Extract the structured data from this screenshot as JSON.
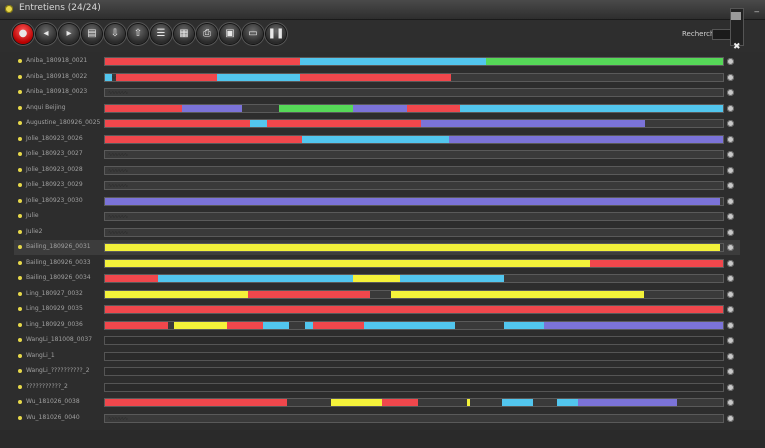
{
  "window": {
    "title": "Entretiens (24/24)",
    "minimize_label": "_"
  },
  "toolbar": {
    "buttons": [
      {
        "name": "record-button",
        "icon": "●"
      },
      {
        "name": "back-button",
        "icon": "◂"
      },
      {
        "name": "forward-button",
        "icon": "▸"
      },
      {
        "name": "document-button",
        "icon": "▤"
      },
      {
        "name": "import-button",
        "icon": "⇩"
      },
      {
        "name": "export-button",
        "icon": "⇧"
      },
      {
        "name": "list-button",
        "icon": "☰"
      },
      {
        "name": "grid-button",
        "icon": "▦"
      },
      {
        "name": "print-button",
        "icon": "⎙"
      },
      {
        "name": "archive-button",
        "icon": "▣"
      },
      {
        "name": "screen-button",
        "icon": "▭"
      },
      {
        "name": "pause-button",
        "icon": "❚❚"
      }
    ],
    "search_label": "Rechercher",
    "close_label": "✖"
  },
  "colors": {
    "red": "#f0474c",
    "blue": "#52c6ee",
    "green": "#56d858",
    "purple": "#7b73d8",
    "yellow": "#f4f23a",
    "grey": "#3a3a3a"
  },
  "rows": [
    {
      "label": "Aniba_180918_0021",
      "segments": [
        [
          0,
          0.315,
          "red"
        ],
        [
          0.315,
          0.617,
          "blue"
        ],
        [
          0.617,
          1,
          "green"
        ]
      ]
    },
    {
      "label": "Aniba_180918_0022",
      "blob": true,
      "segments": [
        [
          0,
          0.012,
          "blue"
        ],
        [
          0.018,
          0.182,
          "red"
        ],
        [
          0.182,
          0.315,
          "blue"
        ],
        [
          0.315,
          0.56,
          "red"
        ]
      ]
    },
    {
      "label": "Aniba_180918_0023",
      "blob": true,
      "segments": []
    },
    {
      "label": "Anqui Beijing",
      "blob": true,
      "segments": [
        [
          0,
          0.125,
          "red"
        ],
        [
          0.125,
          0.222,
          "purple"
        ],
        [
          0.281,
          0.402,
          "green"
        ],
        [
          0.402,
          0.488,
          "purple"
        ],
        [
          0.488,
          0.574,
          "red"
        ],
        [
          0.574,
          1,
          "blue"
        ]
      ]
    },
    {
      "label": "Augustine_180926_0025",
      "blob": true,
      "segments": [
        [
          0,
          0.234,
          "red"
        ],
        [
          0.234,
          0.262,
          "blue"
        ],
        [
          0.262,
          0.512,
          "red"
        ],
        [
          0.512,
          0.874,
          "purple"
        ]
      ]
    },
    {
      "label": "Jolie_180923_0026",
      "blob": true,
      "segments": [
        [
          0,
          0.318,
          "red"
        ],
        [
          0.318,
          0.556,
          "blue"
        ],
        [
          0.556,
          1,
          "purple"
        ]
      ]
    },
    {
      "label": "Jolie_180923_0027",
      "blob": true,
      "segments": []
    },
    {
      "label": "Jolie_180923_0028",
      "blob": true,
      "segments": []
    },
    {
      "label": "Jolie_180923_0029",
      "blob": true,
      "segments": []
    },
    {
      "label": "Jolie_180923_0030",
      "segments": [
        [
          0,
          0.995,
          "purple"
        ]
      ]
    },
    {
      "label": "Julie",
      "blob": true,
      "segments": []
    },
    {
      "label": "Julie2",
      "blob": true,
      "segments": []
    },
    {
      "label": "Bailing_180926_0031",
      "selected": true,
      "segments": [
        [
          0,
          0.995,
          "yellow"
        ]
      ]
    },
    {
      "label": "Bailing_180926_0033",
      "segments": [
        [
          0,
          0.784,
          "yellow"
        ],
        [
          0.784,
          1,
          "red"
        ]
      ]
    },
    {
      "label": "Bailing_180926_0034",
      "blob": true,
      "segments": [
        [
          0,
          0.086,
          "red"
        ],
        [
          0.086,
          0.402,
          "blue"
        ],
        [
          0.402,
          0.478,
          "yellow"
        ],
        [
          0.478,
          0.646,
          "blue"
        ]
      ]
    },
    {
      "label": "Ling_180927_0032",
      "segments": [
        [
          0,
          0.232,
          "yellow"
        ],
        [
          0.232,
          0.429,
          "red"
        ],
        [
          0.463,
          0.872,
          "yellow"
        ]
      ]
    },
    {
      "label": "Ling_180929_0035",
      "blob": true,
      "segments": [
        [
          0,
          1,
          "red"
        ]
      ]
    },
    {
      "label": "Ling_180929_0036",
      "blob": true,
      "segments": [
        [
          0,
          0.102,
          "red"
        ],
        [
          0.112,
          0.197,
          "yellow"
        ],
        [
          0.197,
          0.255,
          "red"
        ],
        [
          0.255,
          0.298,
          "blue"
        ],
        [
          0.323,
          0.337,
          "blue"
        ],
        [
          0.337,
          0.419,
          "red"
        ],
        [
          0.419,
          0.566,
          "blue"
        ],
        [
          0.645,
          0.71,
          "blue"
        ],
        [
          0.71,
          1,
          "purple"
        ]
      ]
    },
    {
      "label": "WangLi_181008_0037",
      "empty": true,
      "segments": []
    },
    {
      "label": "WangLi_1",
      "empty": true,
      "segments": []
    },
    {
      "label": "WangLi_??????????_2",
      "empty": true,
      "segments": []
    },
    {
      "label": "???????????_2",
      "empty": true,
      "segments": []
    },
    {
      "label": "Wu_181026_0038",
      "blob": true,
      "segments": [
        [
          0,
          0.295,
          "red"
        ],
        [
          0.365,
          0.448,
          "yellow"
        ],
        [
          0.448,
          0.507,
          "red"
        ],
        [
          0.586,
          0.59,
          "yellow"
        ],
        [
          0.642,
          0.692,
          "blue"
        ],
        [
          0.731,
          0.765,
          "blue"
        ],
        [
          0.765,
          0.926,
          "purple"
        ]
      ]
    },
    {
      "label": "Wu_181026_0040",
      "blob": true,
      "segments": []
    }
  ],
  "blob_text": "∿∿∿∿∿∿"
}
